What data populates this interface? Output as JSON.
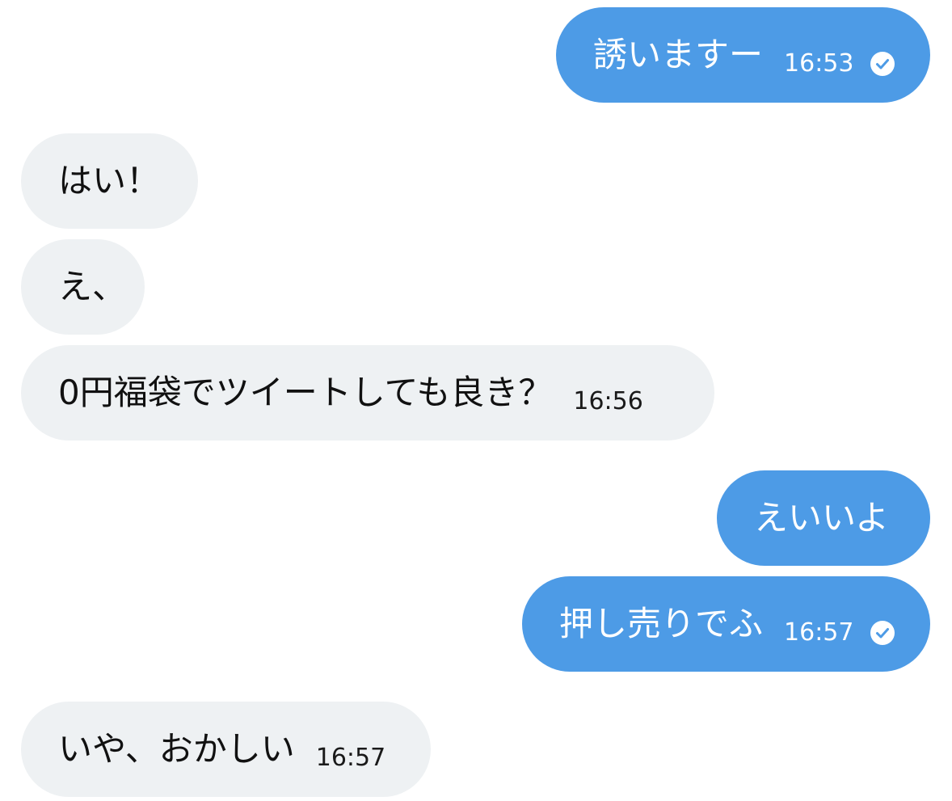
{
  "colors": {
    "outgoing_bubble": "#4d9be6",
    "incoming_bubble": "#eef1f3",
    "outgoing_text": "#ffffff",
    "incoming_text": "#111111"
  },
  "messages": [
    {
      "direction": "out",
      "text": "誘いますー",
      "time": "16:53",
      "icon": "check-circle-icon"
    },
    {
      "direction": "in",
      "text": "はい！"
    },
    {
      "direction": "in",
      "text": "え、"
    },
    {
      "direction": "in",
      "text": "0円福袋でツイートしても良き？",
      "time": "16:56"
    },
    {
      "direction": "out",
      "text": "えいいよ"
    },
    {
      "direction": "out",
      "text": "押し売りでふ",
      "time": "16:57",
      "icon": "check-circle-icon"
    },
    {
      "direction": "in",
      "text": "いや、おかしい",
      "time": "16:57"
    }
  ]
}
